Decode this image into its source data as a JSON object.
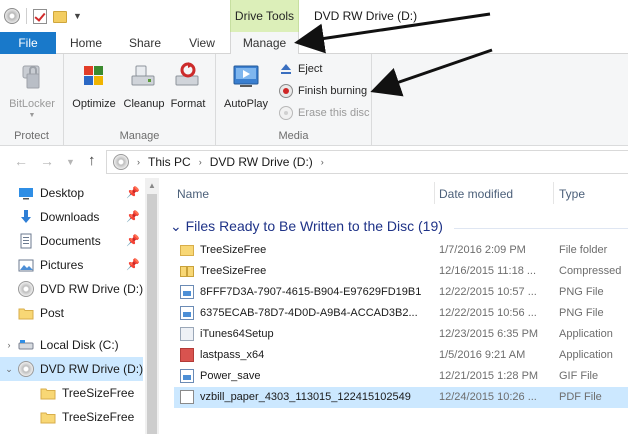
{
  "window": {
    "title": "DVD RW Drive (D:)",
    "context_tab_group": "Drive Tools"
  },
  "ribbon_tabs": {
    "file": "File",
    "home": "Home",
    "share": "Share",
    "view": "View",
    "manage": "Manage"
  },
  "ribbon": {
    "protect": {
      "label": "Protect",
      "bitlocker": "BitLocker"
    },
    "manage": {
      "label": "Manage",
      "optimize": "Optimize",
      "cleanup": "Cleanup",
      "format": "Format"
    },
    "media": {
      "label": "Media",
      "autoplay": "AutoPlay",
      "eject": "Eject",
      "finish_burning": "Finish burning",
      "erase": "Erase this disc"
    }
  },
  "address": {
    "crumbs": [
      "This PC",
      "DVD RW Drive (D:)"
    ]
  },
  "nav_pane": {
    "items": [
      {
        "label": "Desktop",
        "icon": "desktop-icon"
      },
      {
        "label": "Downloads",
        "icon": "downloads-icon"
      },
      {
        "label": "Documents",
        "icon": "documents-icon"
      },
      {
        "label": "Pictures",
        "icon": "pictures-icon"
      },
      {
        "label": "DVD RW Drive (D:)",
        "icon": "disc-icon"
      },
      {
        "label": "Post",
        "icon": "folder-icon"
      },
      {
        "label": "Local Disk (C:)",
        "icon": "drive-icon"
      },
      {
        "label": "DVD RW Drive (D:)",
        "icon": "disc-icon"
      },
      {
        "label": "TreeSizeFree",
        "icon": "folder-icon"
      },
      {
        "label": "TreeSizeFree",
        "icon": "folder-icon"
      }
    ]
  },
  "file_list": {
    "columns": {
      "name": "Name",
      "date": "Date modified",
      "type": "Type"
    },
    "group_title": "Files Ready to Be Written to the Disc (19)",
    "rows": [
      {
        "name": "TreeSizeFree",
        "date": "1/7/2016 2:09 PM",
        "type": "File folder",
        "icon": "folder-icon"
      },
      {
        "name": "TreeSizeFree",
        "date": "12/16/2015 11:18 ...",
        "type": "Compressed",
        "icon": "zip-icon"
      },
      {
        "name": "8FFF7D3A-7907-4615-B904-E97629FD19B1",
        "date": "12/22/2015 10:57 ...",
        "type": "PNG File",
        "icon": "image-icon"
      },
      {
        "name": "6375ECAB-78D7-4D0D-A9B4-ACCAD3B2...",
        "date": "12/22/2015 10:56 ...",
        "type": "PNG File",
        "icon": "image-icon"
      },
      {
        "name": "iTunes64Setup",
        "date": "12/23/2015 6:35 PM",
        "type": "Application",
        "icon": "app-icon"
      },
      {
        "name": "lastpass_x64",
        "date": "1/5/2016 9:21 AM",
        "type": "Application",
        "icon": "lastpass-icon"
      },
      {
        "name": "Power_save",
        "date": "12/21/2015 1:28 PM",
        "type": "GIF File",
        "icon": "image-icon"
      },
      {
        "name": "vzbill_paper_4303_113015_122415102549",
        "date": "12/24/2015 10:26 ...",
        "type": "PDF File",
        "icon": "pdf-icon"
      }
    ]
  },
  "colors": {
    "file_tab": "#1979ca",
    "context_tab": "#dcefb9",
    "selection": "#cce8ff",
    "group_title": "#1e3287"
  }
}
